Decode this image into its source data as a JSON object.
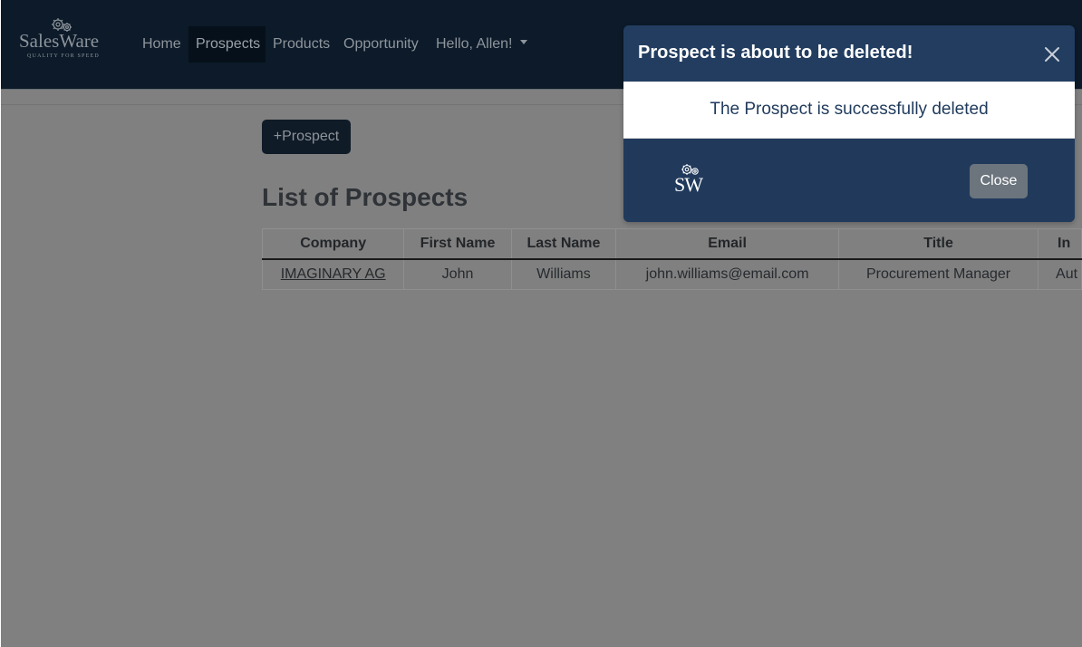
{
  "app": {
    "logo_text": "SalesWare",
    "logo_tagline": "QUALITY FOR SPEED"
  },
  "nav": {
    "items": [
      {
        "label": "Home"
      },
      {
        "label": "Prospects",
        "active": true
      },
      {
        "label": "Products"
      },
      {
        "label": "Opportunity"
      }
    ],
    "user_menu_label": "Hello, Allen!"
  },
  "main": {
    "add_button_label": "+Prospect",
    "list_title": "List of Prospects",
    "table": {
      "headers": [
        "Company",
        "First Name",
        "Last Name",
        "Email",
        "Title",
        "In"
      ],
      "rows": [
        [
          "IMAGINARY AG",
          "John",
          "Williams",
          "john.williams@email.com",
          "Procurement Manager",
          "Aut"
        ]
      ]
    }
  },
  "modal": {
    "title": "Prospect is about to be deleted!",
    "message": "The Prospect is successfully deleted",
    "footer_logo_text": "SW",
    "close_button_label": "Close",
    "close_icon": "close-icon"
  },
  "colors": {
    "navbar_bg": "#0c1a29",
    "modal_bg": "#213a5c",
    "close_button_bg": "#6c757d",
    "overlay": "#808080"
  }
}
